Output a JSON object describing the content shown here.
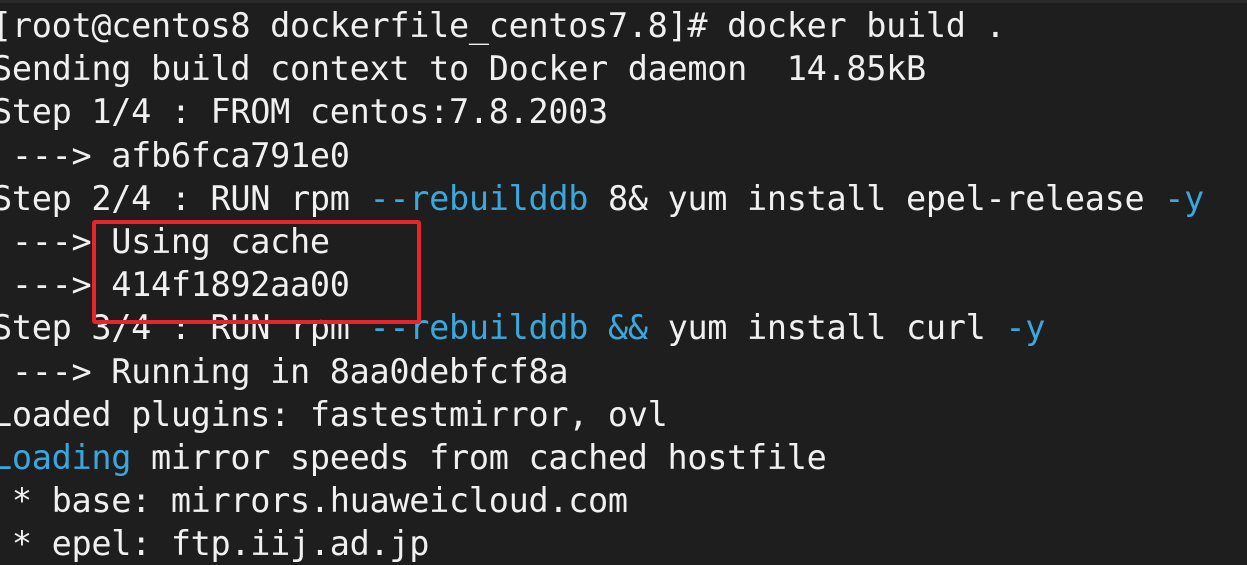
{
  "terminal": {
    "colors": {
      "background": "#1e1e1e",
      "foreground": "#f0f0f0",
      "cyan": "#3aa8dd",
      "highlight_box": "#e8252d"
    },
    "lines": [
      {
        "segments": [
          {
            "text": "[root@centos8 dockerfile_centos7.8]# docker build ."
          }
        ]
      },
      {
        "segments": [
          {
            "text": "Sending build context to Docker daemon  14.85kB"
          }
        ]
      },
      {
        "segments": [
          {
            "text": "Step 1/4 : FROM centos:7.8.2003"
          }
        ]
      },
      {
        "segments": [
          {
            "text": " ---> afb6fca791e0"
          }
        ]
      },
      {
        "segments": [
          {
            "text": "Step 2/4 : RUN rpm "
          },
          {
            "text": "--rebuilddb",
            "color": "cyan"
          },
          {
            "text": " 8& yum install epel-release "
          },
          {
            "text": "-y",
            "color": "cyan"
          }
        ]
      },
      {
        "segments": [
          {
            "text": " ---> Using cache"
          }
        ]
      },
      {
        "segments": [
          {
            "text": " ---> 414f1892aa00"
          }
        ]
      },
      {
        "segments": [
          {
            "text": "Step 3/4 : RUN rpm "
          },
          {
            "text": "--rebuilddb",
            "color": "cyan"
          },
          {
            "text": " "
          },
          {
            "text": "&&",
            "color": "cyan"
          },
          {
            "text": " yum install curl "
          },
          {
            "text": "-y",
            "color": "cyan"
          }
        ]
      },
      {
        "segments": [
          {
            "text": " ---> Running in 8aa0debfcf8a"
          }
        ]
      },
      {
        "segments": [
          {
            "text": "Loaded plugins: fastestmirror, ovl"
          }
        ]
      },
      {
        "segments": [
          {
            "text": "Loading",
            "color": "cyan"
          },
          {
            "text": " mirror speeds from cached hostfile"
          }
        ]
      },
      {
        "segments": [
          {
            "text": " * base: mirrors.huaweicloud.com"
          }
        ]
      },
      {
        "segments": [
          {
            "text": " * epel: ftp.iij.ad.jp"
          }
        ]
      }
    ]
  }
}
